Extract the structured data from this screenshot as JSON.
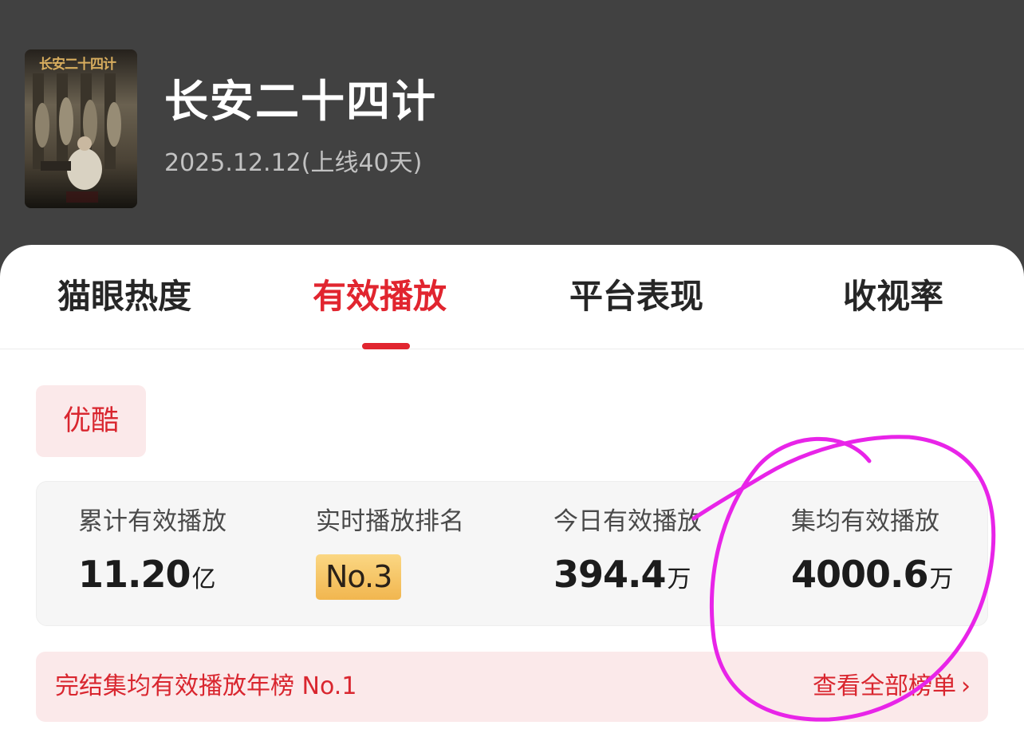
{
  "header": {
    "poster_title": "长安二十四计",
    "title": "长安二十四计",
    "release_info": "2025.12.12(上线40天)"
  },
  "tabs": [
    {
      "label": "猫眼热度",
      "active": false
    },
    {
      "label": "有效播放",
      "active": true
    },
    {
      "label": "平台表现",
      "active": false
    },
    {
      "label": "收视率",
      "active": false
    }
  ],
  "platform": {
    "label": "优酷"
  },
  "stats": {
    "cumulative": {
      "label": "累计有效播放",
      "value": "11.20",
      "unit": "亿"
    },
    "rank": {
      "label": "实时播放排名",
      "value": "No.3"
    },
    "today": {
      "label": "今日有效播放",
      "value": "394.4",
      "unit": "万"
    },
    "per_episode": {
      "label": "集均有效播放",
      "value": "4000.6",
      "unit": "万"
    }
  },
  "ranking": {
    "text": "完结集均有效播放年榜 No.1",
    "link": "查看全部榜单",
    "chevron": "›"
  },
  "colors": {
    "accent": "#e1252f",
    "header_bg": "#414141",
    "annotation": "#e824e8"
  }
}
